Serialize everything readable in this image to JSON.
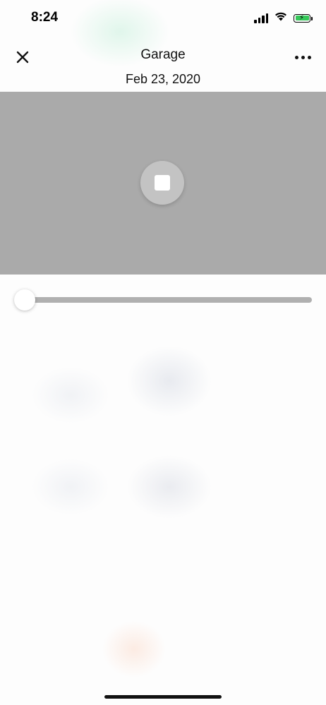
{
  "status_bar": {
    "time": "8:24",
    "icons": [
      "signal-icon",
      "wifi-icon",
      "battery-charging-icon"
    ],
    "battery_color": "#35c759"
  },
  "header": {
    "close_icon": "close-icon",
    "title": "Garage",
    "subtitle": "Feb 23, 2020",
    "more_icon": "more-horizontal-icon"
  },
  "player": {
    "background_color": "#aaaaaa",
    "control_icon": "stop-icon",
    "progress": 0
  }
}
